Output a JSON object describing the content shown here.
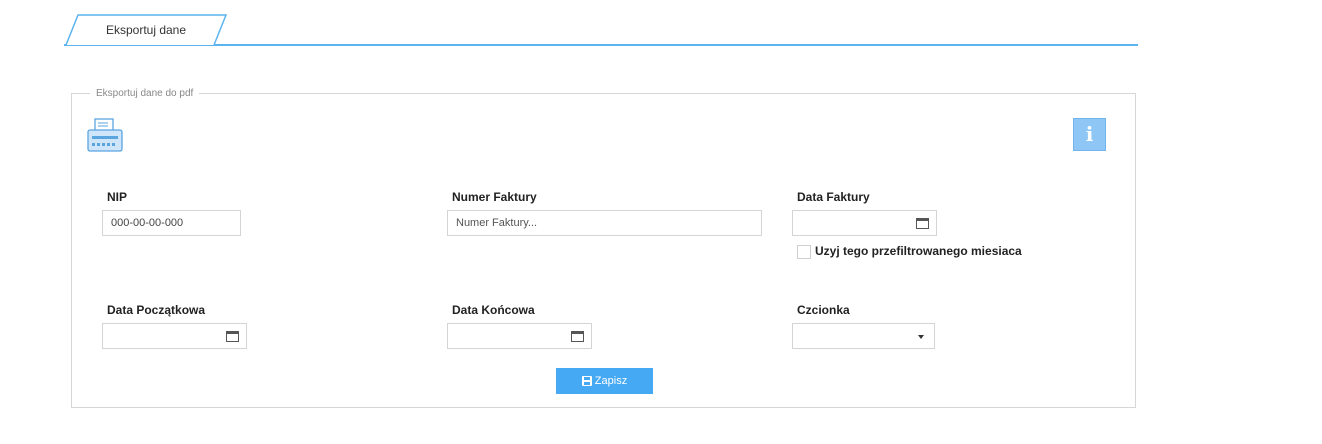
{
  "tabs": [
    {
      "label": "Eksportuj dane",
      "active": true
    }
  ],
  "panel": {
    "legend": "Eksportuj dane do pdf",
    "icons": {
      "left": "printer-icon",
      "right": "info-icon"
    },
    "info_label": "i"
  },
  "fields": {
    "nip": {
      "label": "NIP",
      "value": "000-00-00-000"
    },
    "invoice_number": {
      "label": "Numer Faktury",
      "placeholder": "Numer Faktury..."
    },
    "invoice_date": {
      "label": "Data Faktury",
      "value": ""
    },
    "use_filtered_month": {
      "label": "Uzyj tego przefiltrowanego miesiaca",
      "checked": false
    },
    "start_date": {
      "label": "Data Początkowa",
      "value": ""
    },
    "end_date": {
      "label": "Data Końcowa",
      "value": ""
    },
    "font": {
      "label": "Czcionka",
      "value": ""
    }
  },
  "actions": {
    "save_label": "Zapisz",
    "save_icon": "floppy-disk-icon"
  },
  "colors": {
    "accent": "#45a9f3",
    "tab_line": "#5bb4ee",
    "info_bg": "#8ec6f6"
  }
}
